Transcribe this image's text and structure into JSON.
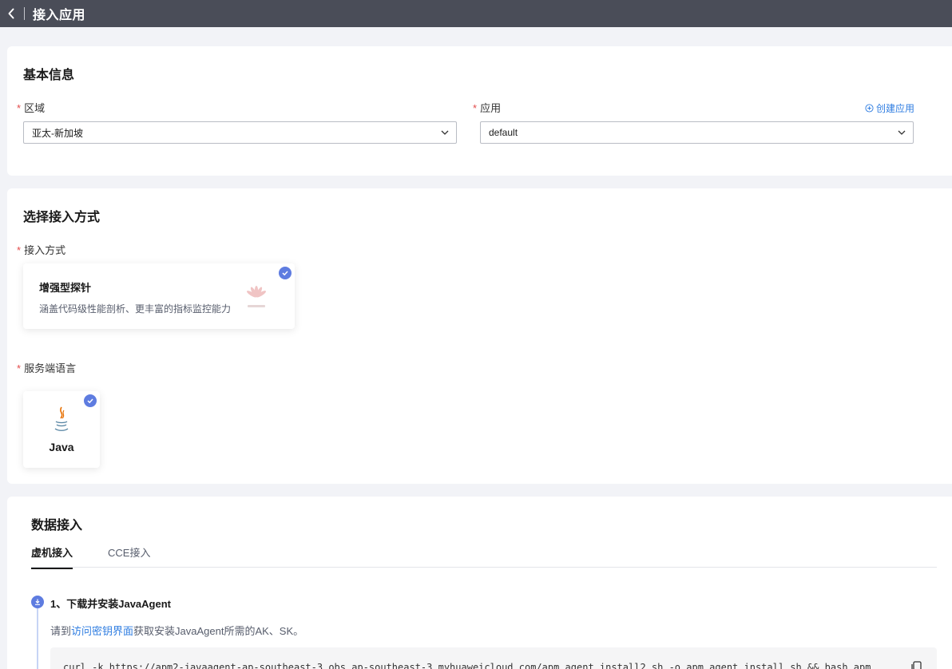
{
  "header": {
    "title": "接入应用"
  },
  "basic": {
    "title": "基本信息",
    "region_label": "区域",
    "region_value": "亚太-新加坡",
    "app_label": "应用",
    "app_value": "default",
    "create_app": "创建应用"
  },
  "method": {
    "title": "选择接入方式",
    "method_label": "接入方式",
    "card_title": "增强型探针",
    "card_desc": "涵盖代码级性能剖析、更丰富的指标监控能力",
    "lang_label": "服务端语言",
    "lang_name": "Java"
  },
  "data_access": {
    "title": "数据接入",
    "tabs": [
      {
        "label": "虚机接入",
        "active": true
      },
      {
        "label": "CCE接入",
        "active": false
      }
    ],
    "step1_title": "1、下载并安装JavaAgent",
    "step1_desc_prefix": "请到",
    "step1_desc_link": "访问密钥界面",
    "step1_desc_suffix": "获取安装JavaAgent所需的AK、SK。",
    "code": "curl -k https://apm2-javaagent-ap-southeast-3.obs.ap-southeast-3.myhuaweicloud.com/apm_agent_install2.sh -o apm_agent_install.sh && bash apm_agent_install.sh"
  },
  "colors": {
    "accent": "#5e7ce0",
    "link": "#2f7de1",
    "required": "#e34b4b",
    "topbar": "#4a4d58"
  }
}
